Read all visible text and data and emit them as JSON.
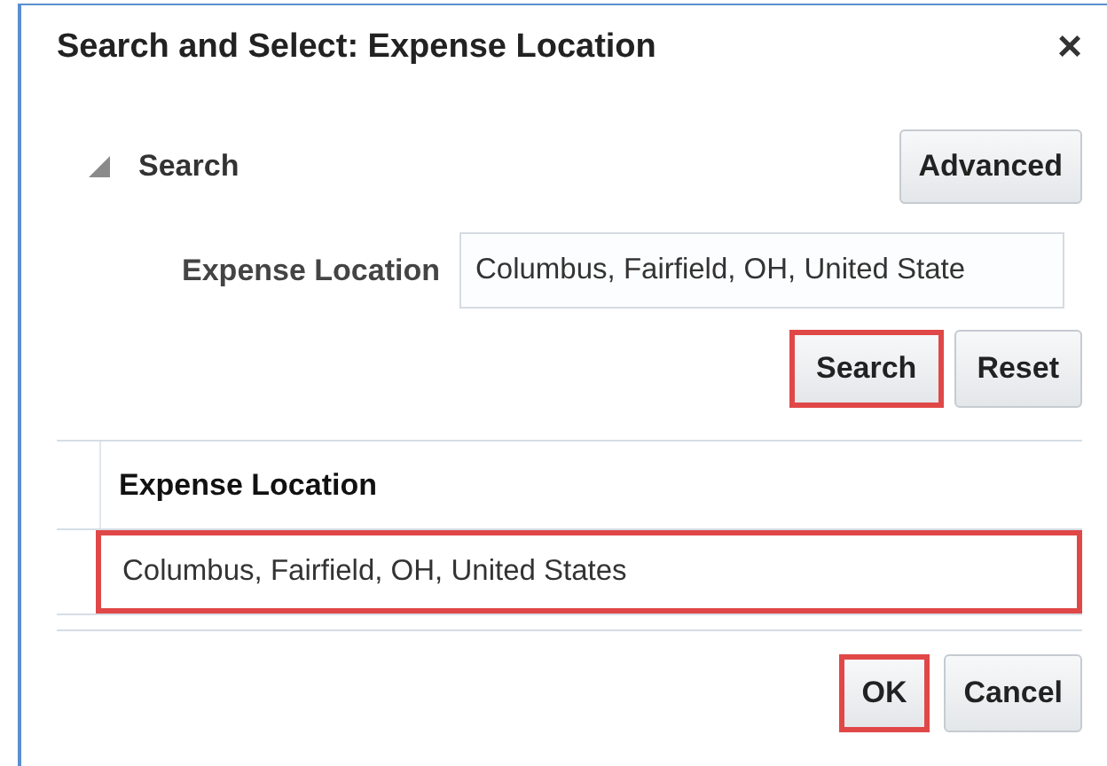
{
  "dialog": {
    "title": "Search and Select: Expense Location",
    "close": "×"
  },
  "search": {
    "header": "Search",
    "expanded": true,
    "advanced_button": {
      "label": "Advanced",
      "highlighted": false
    },
    "field": {
      "label": "Expense Location",
      "value": "Columbus, Fairfield, OH, United State"
    },
    "buttons": [
      {
        "label": "Search",
        "highlighted": true
      },
      {
        "label": "Reset",
        "highlighted": false
      }
    ]
  },
  "table": {
    "columns": [
      "Expense Location"
    ],
    "rows": [
      {
        "cells": [
          "Columbus, Fairfield, OH, United States"
        ],
        "highlighted": true
      }
    ]
  },
  "footer_buttons": [
    {
      "label": "OK",
      "highlighted": true
    },
    {
      "label": "Cancel",
      "highlighted": false
    }
  ]
}
